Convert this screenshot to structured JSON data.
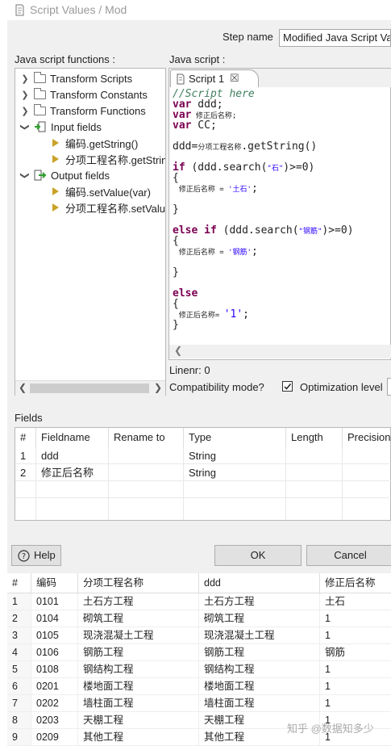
{
  "window": {
    "title": "Script Values / Mod"
  },
  "step": {
    "label": "Step name",
    "value": "Modified Java Script Value"
  },
  "functions_panel": {
    "label": "Java script functions :",
    "items": [
      {
        "label": "Transform Scripts"
      },
      {
        "label": "Transform Constants"
      },
      {
        "label": "Transform Functions"
      },
      {
        "label": "Input fields"
      },
      {
        "label": "编码.getString()"
      },
      {
        "label": "分项工程名称.getString()"
      },
      {
        "label": "Output fields"
      },
      {
        "label": "编码.setValue(var)"
      },
      {
        "label": "分项工程名称.setValue(var)"
      }
    ]
  },
  "script_panel": {
    "label": "Java script :",
    "tab": "Script 1",
    "code": {
      "l1": "//Script here",
      "kw_var": "var",
      "v1": " ddd;",
      "v2": " 修正后名称;",
      "v3": " CC;",
      "l5a": "ddd=",
      "l5b": "分项工程名称",
      "l5c": ".getString()",
      "kw_if": "if",
      "if1a": " (ddd.search(",
      "if1s": "\"石\"",
      "if1b": ")>=0)",
      "brace_open": "{",
      "brace_close": "}",
      "asg": "修正后名称",
      "eq": " = ",
      "val1": "'土石'",
      "semi": ";",
      "kw_elseif": "else if",
      "ei1a": " (ddd.search(",
      "ei1s": "\"钢筋\"",
      "ei1b": ")>=0)",
      "val2": "'钢筋'",
      "kw_else": "else",
      "eq2": "= ",
      "val3": "'1'"
    },
    "linenr": "Linenr: 0",
    "compat_label": "Compatibility mode?",
    "opt_label": "Optimization level"
  },
  "fields": {
    "label": "Fields",
    "columns": [
      "#",
      "Fieldname",
      "Rename to",
      "Type",
      "Length",
      "Precision"
    ],
    "rows": [
      {
        "n": "1",
        "name": "ddd",
        "rename": "",
        "type": "String"
      },
      {
        "n": "2",
        "name": "修正后名称",
        "rename": "",
        "type": "String"
      }
    ]
  },
  "buttons": {
    "help": "Help",
    "ok": "OK",
    "cancel": "Cancel"
  },
  "preview": {
    "columns": [
      "#",
      "编码",
      "分项工程名称",
      "ddd",
      "修正后名称"
    ],
    "rows": [
      [
        "1",
        "0101",
        "土石方工程",
        "土石方工程",
        "土石"
      ],
      [
        "2",
        "0104",
        "砌筑工程",
        "砌筑工程",
        "1"
      ],
      [
        "3",
        "0105",
        "现浇混凝土工程",
        "现浇混凝土工程",
        "1"
      ],
      [
        "4",
        "0106",
        "钢筋工程",
        "钢筋工程",
        "钢筋"
      ],
      [
        "5",
        "0108",
        "钢结构工程",
        "钢结构工程",
        "1"
      ],
      [
        "6",
        "0201",
        "楼地面工程",
        "楼地面工程",
        "1"
      ],
      [
        "7",
        "0202",
        "墙柱面工程",
        "墙柱面工程",
        "1"
      ],
      [
        "8",
        "0203",
        "天棚工程",
        "天棚工程",
        "1"
      ],
      [
        "9",
        "0209",
        "其他工程",
        "其他工程",
        "1"
      ]
    ]
  },
  "watermark": "知乎 @数据知多少",
  "colors": {
    "keyword": "#7b0052",
    "comment": "#3f7f5f",
    "string": "#2a00ff",
    "dialog_bg": "#f0f0f0"
  }
}
